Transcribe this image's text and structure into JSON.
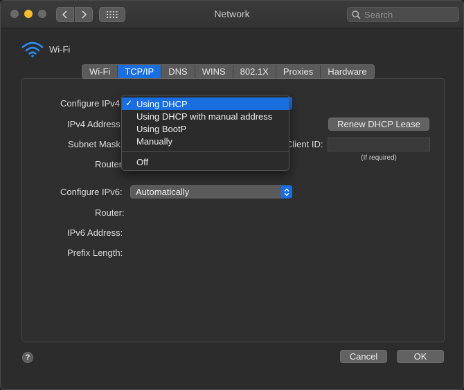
{
  "window": {
    "title": "Network"
  },
  "search": {
    "placeholder": "Search"
  },
  "header": {
    "interface_name": "Wi-Fi",
    "icon": "wifi-icon"
  },
  "tabs": [
    {
      "label": "Wi-Fi",
      "active": false
    },
    {
      "label": "TCP/IP",
      "active": true
    },
    {
      "label": "DNS",
      "active": false
    },
    {
      "label": "WINS",
      "active": false
    },
    {
      "label": "802.1X",
      "active": false
    },
    {
      "label": "Proxies",
      "active": false
    },
    {
      "label": "Hardware",
      "active": false
    }
  ],
  "ipv4": {
    "configure_label": "Configure IPv4",
    "address_label": "IPv4 Address",
    "subnet_label": "Subnet Mask",
    "router_label": "Router",
    "renew_button": "Renew DHCP Lease",
    "dhcp_client_label": "Client ID:",
    "dhcp_client_value": "",
    "dhcp_client_hint": "(If required)"
  },
  "ipv4_menu": {
    "options": [
      "Using DHCP",
      "Using DHCP with manual address",
      "Using BootP",
      "Manually"
    ],
    "selected": "Using DHCP",
    "extra_option": "Off"
  },
  "ipv6": {
    "configure_label": "Configure IPv6:",
    "configure_value": "Automatically",
    "router_label": "Router:",
    "address_label": "IPv6 Address:",
    "prefix_label": "Prefix Length:"
  },
  "footer": {
    "help_label": "?",
    "cancel_button": "Cancel",
    "ok_button": "OK"
  },
  "colors": {
    "accent": "#1a6fe0",
    "window_bg": "#2c2c2c",
    "button_bg": "#626262",
    "minimize": "#f5bd2e"
  }
}
